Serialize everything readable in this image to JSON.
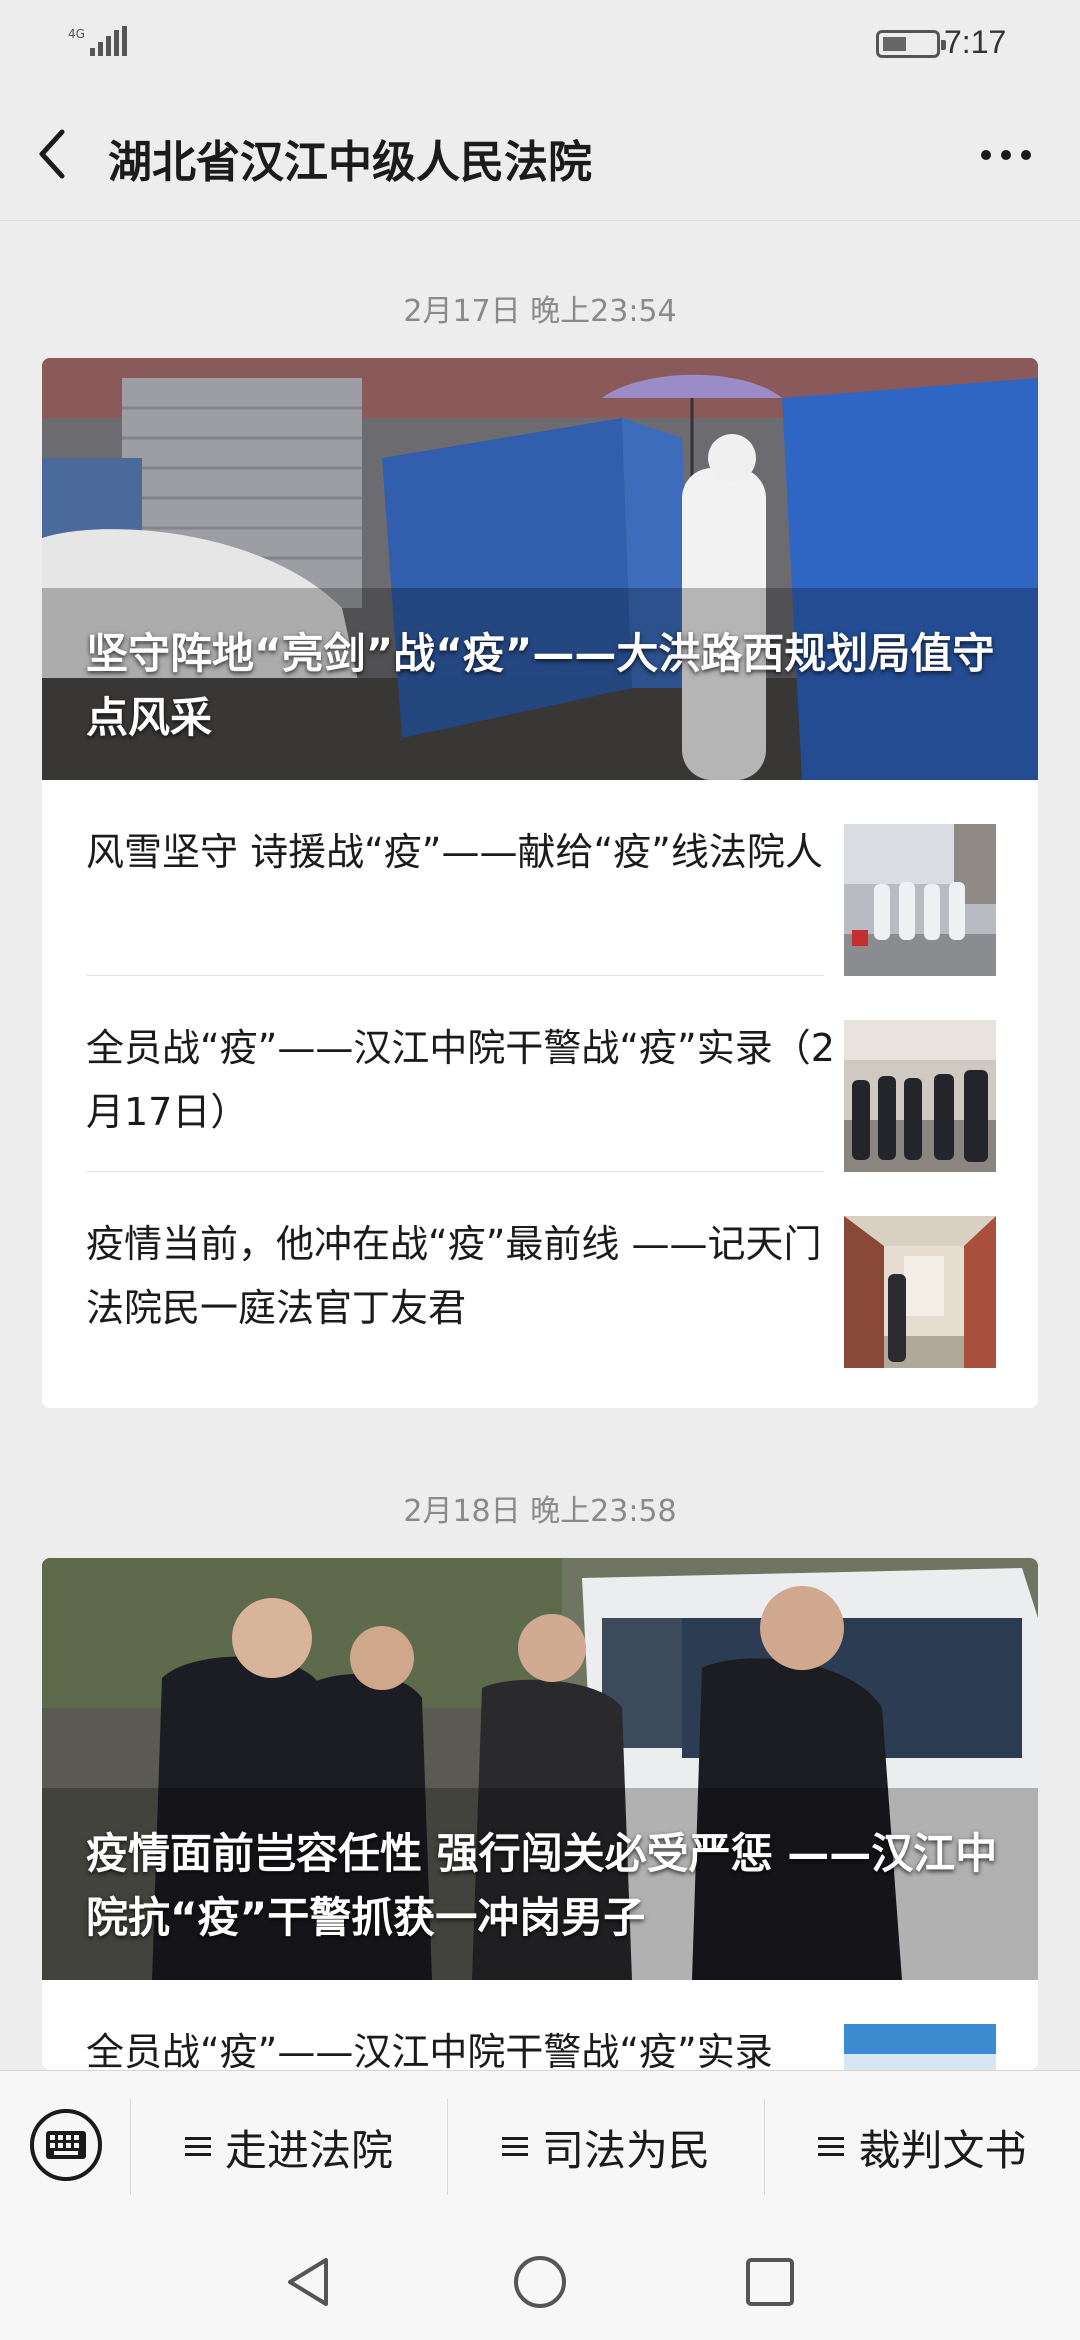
{
  "status_bar": {
    "network": "4G",
    "time": "7:17"
  },
  "header": {
    "title": "湖北省汉江中级人民法院"
  },
  "groups": [
    {
      "timestamp": "2月17日 晚上23:54",
      "hero_title": "坚守阵地“亮剑”战“疫”——大洪路西规划局值守点风采",
      "items": [
        {
          "title": "风雪坚守 诗援战“疫”——献给“疫”线法院人"
        },
        {
          "title": "全员战“疫”——汉江中院干警战“疫”实录（2月17日）"
        },
        {
          "title": "疫情当前，他冲在战“疫”最前线 ——记天门法院民一庭法官丁友君"
        }
      ]
    },
    {
      "timestamp": "2月18日 晚上23:58",
      "hero_title": "疫情面前岂容任性 强行闯关必受严惩 ——汉江中院抗“疫”干警抓获一冲岗男子",
      "items": [
        {
          "title": "全员战“疫”——汉江中院干警战“疫”实录"
        }
      ]
    }
  ],
  "bottom_menu": [
    {
      "label": "走进法院"
    },
    {
      "label": "司法为民"
    },
    {
      "label": "裁判文书"
    }
  ],
  "icons": {
    "back": "chevron-left-icon",
    "more": "more-dots-icon",
    "keyboard": "keyboard-icon",
    "menu": "hamburger-icon",
    "nav": [
      "nav-back-icon",
      "nav-home-icon",
      "nav-recents-icon"
    ]
  }
}
